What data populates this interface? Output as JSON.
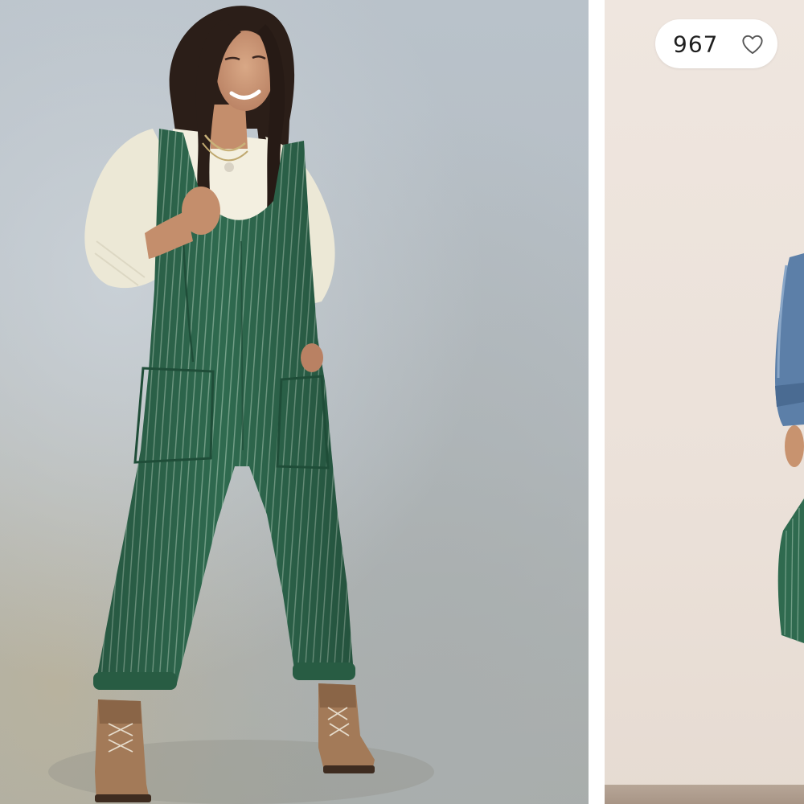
{
  "gallery": {
    "likes": {
      "count": "967"
    },
    "icons": {
      "like": "heart-outline-icon"
    },
    "colors": {
      "overall_green": "#2f6a4f",
      "badge_background": "#ffffff",
      "slide2_background": "#ebe1d9"
    }
  }
}
